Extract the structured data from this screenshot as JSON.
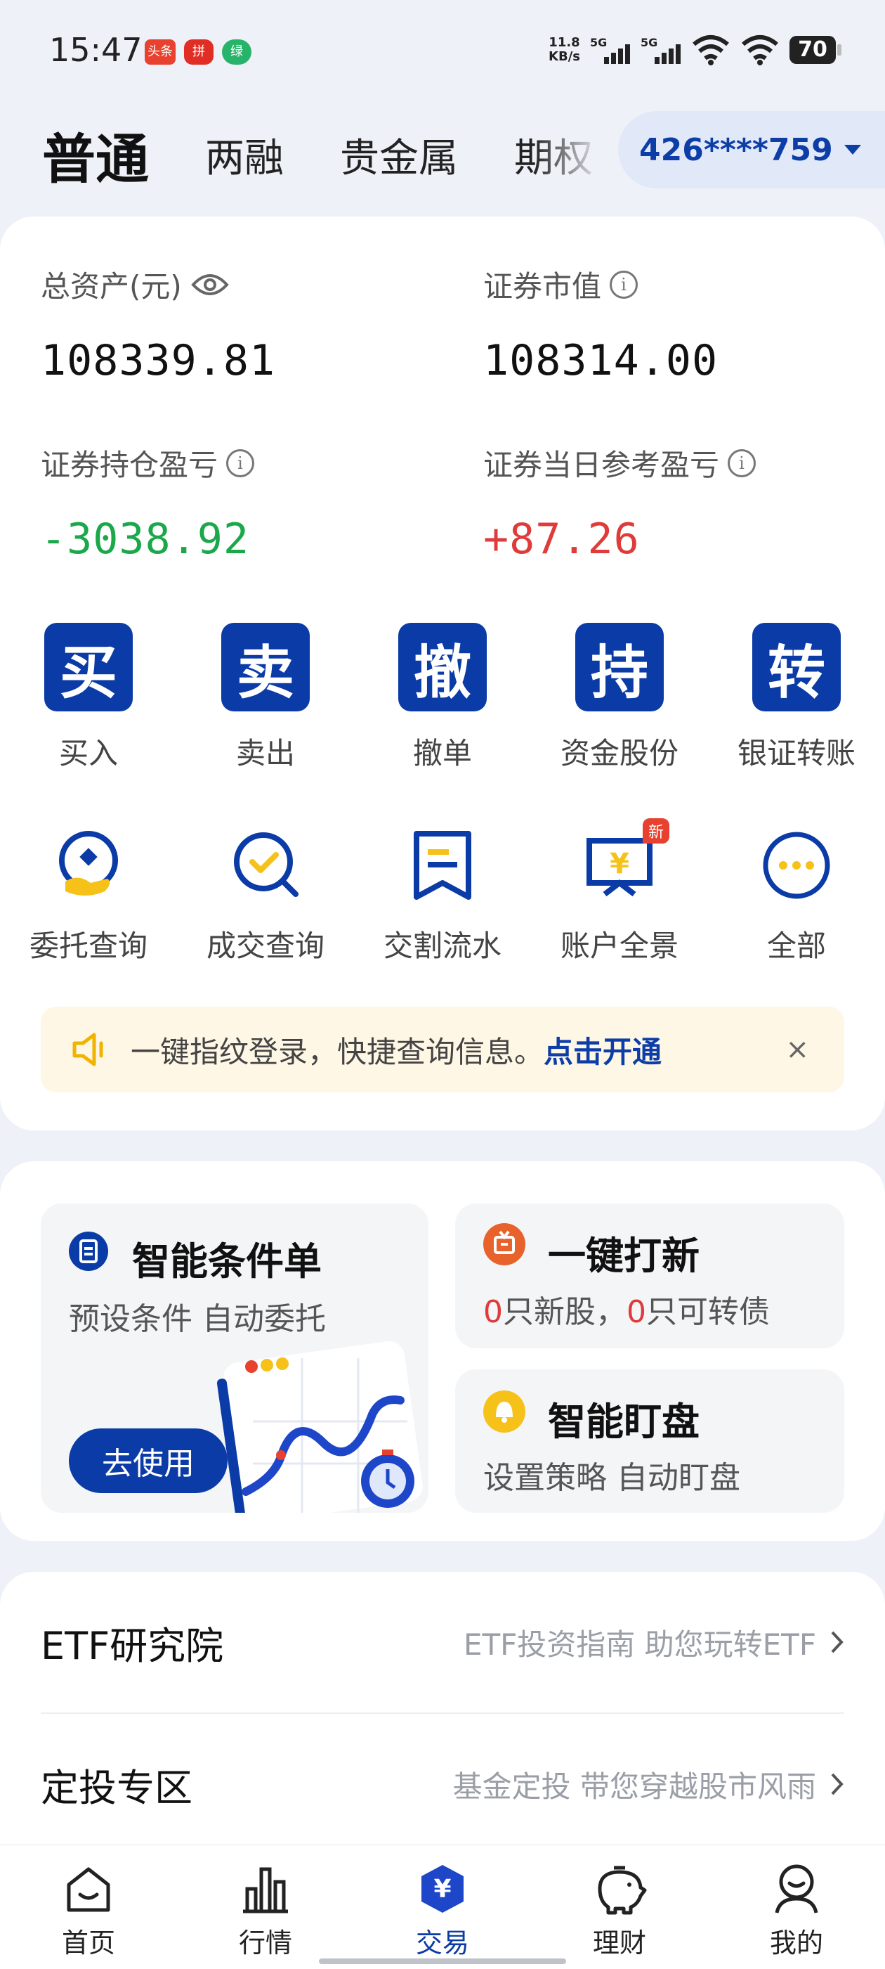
{
  "status_bar": {
    "time": "15:47",
    "apps": [
      "头条",
      "拼",
      "绿"
    ],
    "net_speed": "11.8",
    "net_unit": "KB/s",
    "sim1": "5G",
    "sim2": "5G",
    "battery": "70"
  },
  "tabs": [
    "普通",
    "两融",
    "贵金属",
    "期权"
  ],
  "account": "426****759",
  "assets": {
    "total_label": "总资产(元)",
    "total_value": "108339.81",
    "market_label": "证券市值",
    "market_value": "108314.00",
    "holding_pl_label": "证券持仓盈亏",
    "holding_pl_value": "-3038.92",
    "daily_pl_label": "证券当日参考盈亏",
    "daily_pl_value": "+87.26"
  },
  "primary_actions": [
    {
      "glyph": "买",
      "label": "买入"
    },
    {
      "glyph": "卖",
      "label": "卖出"
    },
    {
      "glyph": "撤",
      "label": "撤单"
    },
    {
      "glyph": "持",
      "label": "资金股份"
    },
    {
      "glyph": "转",
      "label": "银证转账"
    }
  ],
  "secondary_actions": [
    {
      "icon": "entrust-query-icon",
      "label": "委托查询"
    },
    {
      "icon": "deal-query-icon",
      "label": "成交查询"
    },
    {
      "icon": "delivery-flow-icon",
      "label": "交割流水"
    },
    {
      "icon": "account-overview-icon",
      "label": "账户全景",
      "badge": "新"
    },
    {
      "icon": "more-icon",
      "label": "全部"
    }
  ],
  "notice": {
    "text": "一键指纹登录，快捷查询信息。",
    "link": "点击开通",
    "close": "×"
  },
  "smart_order": {
    "title": "智能条件单",
    "subtitle": "预设条件 自动委托",
    "button": "去使用"
  },
  "ipo": {
    "title": "一键打新",
    "count1": "0",
    "text1": "只新股，",
    "count2": "0",
    "text2": "只可转债"
  },
  "smart_watch": {
    "title": "智能盯盘",
    "subtitle": "设置策略 自动盯盘"
  },
  "rows": [
    {
      "title": "ETF研究院",
      "desc": "ETF投资指南 助您玩转ETF"
    },
    {
      "title": "定投专区",
      "desc": "基金定投 带您穿越股市风雨"
    }
  ],
  "bottom_nav": [
    {
      "label": "首页"
    },
    {
      "label": "行情"
    },
    {
      "label": "交易",
      "glyph": "¥"
    },
    {
      "label": "理财"
    },
    {
      "label": "我的"
    }
  ],
  "colors": {
    "primary": "#0b3ba6",
    "negative": "#1aa84a",
    "positive": "#e03b3b",
    "accent_yellow": "#f6c21a"
  }
}
